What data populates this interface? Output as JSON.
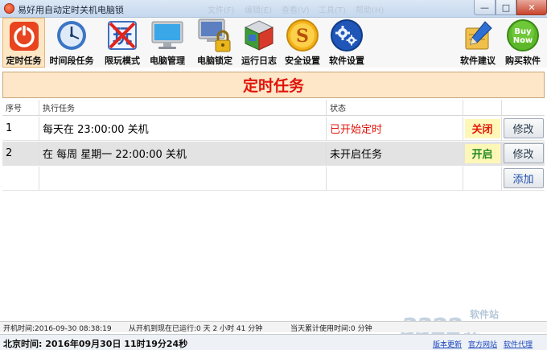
{
  "window": {
    "title": "易好用自动定时关机电脑锁",
    "ghost_menu": [
      "文件(F)",
      "编辑(E)",
      "查看(V)",
      "工具(T)",
      "帮助(H)"
    ],
    "controls": {
      "minimize": "—",
      "maximize": "□",
      "close": "✕"
    }
  },
  "toolbar": {
    "items": [
      {
        "label": "定时任务",
        "icon": "power-icon",
        "active": true
      },
      {
        "label": "时间段任务",
        "icon": "clock-icon"
      },
      {
        "label": "限玩模式",
        "icon": "play-limit-icon"
      },
      {
        "label": "电脑管理",
        "icon": "monitor-icon"
      },
      {
        "label": "电脑锁定",
        "icon": "lock-computer-icon"
      },
      {
        "label": "运行日志",
        "icon": "log-cube-icon"
      },
      {
        "label": "安全设置",
        "icon": "security-s-icon"
      },
      {
        "label": "软件设置",
        "icon": "gear-icon"
      },
      {
        "label": "软件建议",
        "icon": "pen-notebook-icon"
      },
      {
        "label": "购买软件",
        "icon": "buy-now-icon",
        "badge": "Buy Now"
      }
    ]
  },
  "banner": {
    "title": "定时任务"
  },
  "table": {
    "headers": [
      "序号",
      "执行任务",
      "状态",
      "",
      ""
    ],
    "rows": [
      {
        "index": "1",
        "task": "每天在 23:00:00 关机",
        "status": "已开始定时",
        "toggle": "关闭",
        "action": "修改"
      },
      {
        "index": "2",
        "task": "在 每周 星期一 22:00:00 关机",
        "status": "未开启任务",
        "toggle": "开启",
        "action": "修改"
      },
      {
        "index": "",
        "task": "",
        "status": "",
        "toggle": "",
        "action": "添加"
      }
    ]
  },
  "status": {
    "boot_time": "开机时间:2016-09-30 08:38:19",
    "uptime": "从开机到现在已运行:0 天 2 小时 41 分钟",
    "usage_today": "当天累计使用时间:0 分钟",
    "clock": "北京时间: 2016年09月30日  11时19分24秒",
    "links": [
      "版本更新",
      "官方网站",
      "软件代理"
    ]
  },
  "watermark": {
    "number": "3322",
    "suffix": ".cc",
    "tag": "软件站"
  },
  "colors": {
    "accent_red": "#e0140a",
    "accent_green": "#1f8a1d",
    "banner_bg": "#fde7c8",
    "link": "#1a46c0"
  }
}
